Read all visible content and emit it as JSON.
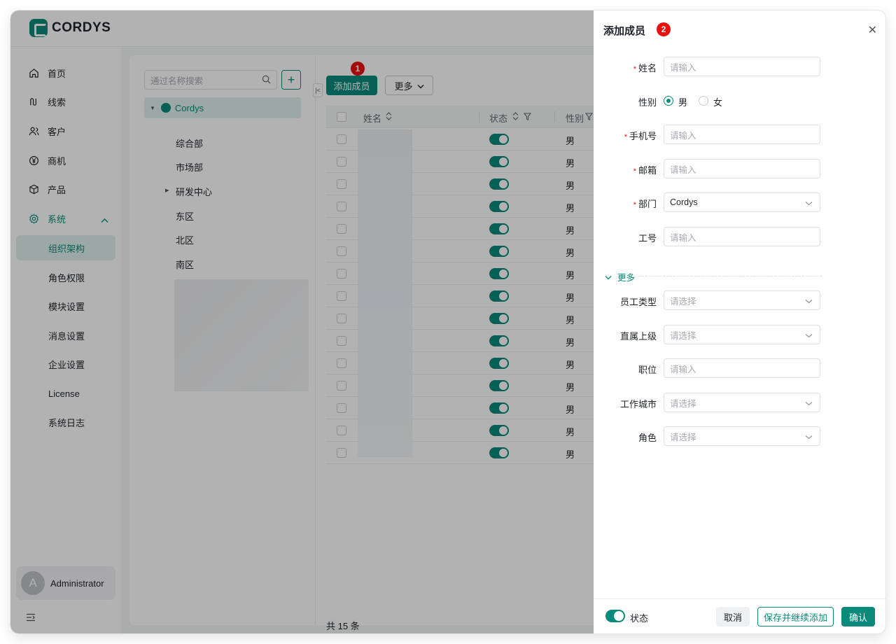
{
  "app": {
    "name": "CORDYS"
  },
  "sidebar": {
    "items": [
      {
        "label": "首页",
        "icon": "home-icon"
      },
      {
        "label": "线索",
        "icon": "clue-icon"
      },
      {
        "label": "客户",
        "icon": "customer-icon"
      },
      {
        "label": "商机",
        "icon": "yen-icon"
      },
      {
        "label": "产品",
        "icon": "cube-icon"
      },
      {
        "label": "系统",
        "icon": "gear-icon"
      }
    ],
    "sub_items": [
      "组织架构",
      "角色权限",
      "模块设置",
      "消息设置",
      "企业设置",
      "License",
      "系统日志"
    ],
    "user": {
      "initial": "A",
      "name": "Administrator"
    }
  },
  "tree": {
    "search_placeholder": "通过名称搜索",
    "root": "Cordys",
    "nodes": [
      "综合部",
      "市场部",
      "研发中心",
      "东区",
      "北区",
      "南区"
    ]
  },
  "toolbar": {
    "add_member": "添加成员",
    "more": "更多",
    "badge_1": "1"
  },
  "table": {
    "headers": {
      "name": "姓名",
      "status": "状态",
      "gender": "性别"
    },
    "rows": [
      "男",
      "男",
      "男",
      "男",
      "男",
      "男",
      "男",
      "男",
      "男",
      "男",
      "男",
      "男",
      "男",
      "男",
      "男"
    ],
    "total": "共 15 条"
  },
  "drawer": {
    "title": "添加成员",
    "badge_2": "2",
    "fields": {
      "name": {
        "label": "姓名",
        "placeholder": "请输入"
      },
      "gender": {
        "label": "性别",
        "male": "男",
        "female": "女"
      },
      "phone": {
        "label": "手机号",
        "placeholder": "请输入"
      },
      "email": {
        "label": "邮箱",
        "placeholder": "请输入"
      },
      "dept": {
        "label": "部门",
        "value": "Cordys"
      },
      "empno": {
        "label": "工号",
        "placeholder": "请输入"
      },
      "more": "更多",
      "emp_type": {
        "label": "员工类型",
        "placeholder": "请选择"
      },
      "supervisor": {
        "label": "直属上级",
        "placeholder": "请选择"
      },
      "position": {
        "label": "职位",
        "placeholder": "请输入"
      },
      "city": {
        "label": "工作城市",
        "placeholder": "请选择"
      },
      "role": {
        "label": "角色",
        "placeholder": "请选择"
      }
    },
    "footer": {
      "status_label": "状态",
      "cancel": "取消",
      "save_continue": "保存并继续添加",
      "confirm": "确认"
    }
  },
  "colors": {
    "accent": "#0a8a7a",
    "badge": "#e8110f"
  }
}
